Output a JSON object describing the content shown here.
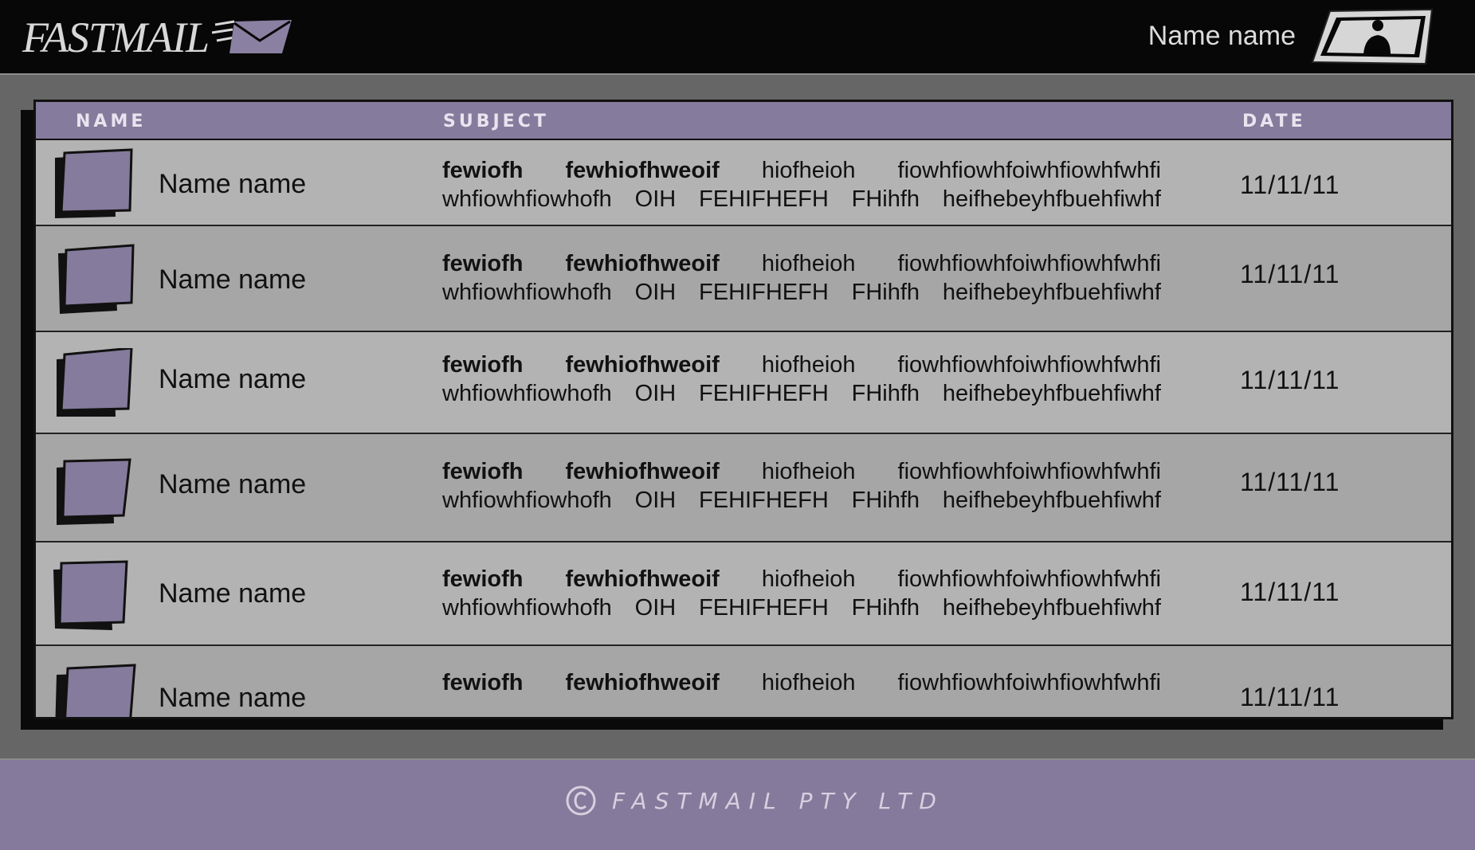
{
  "header": {
    "logo_text": "FASTMAIL",
    "user_name": "Name name"
  },
  "columns": {
    "name": "NAME",
    "subject": "SUBJECT",
    "date": "DATE"
  },
  "messages": [
    {
      "name": "Name name",
      "subject_line1": [
        "fewiofh",
        "fewhiofhweoif",
        "hiofheioh",
        "fiowhfiowhfoiwhfiowhfwhfi"
      ],
      "subject_line2": [
        "whfiowhfiowhofh",
        "OIH",
        "FEHIFHEFH",
        "FHihfh",
        "heifhebeyhfbuehfiwhf"
      ],
      "date": "11/11/11"
    },
    {
      "name": "Name name",
      "subject_line1": [
        "fewiofh",
        "fewhiofhweoif",
        "hiofheioh",
        "fiowhfiowhfoiwhfiowhfwhfi"
      ],
      "subject_line2": [
        "whfiowhfiowhofh",
        "OIH",
        "FEHIFHEFH",
        "FHihfh",
        "heifhebeyhfbuehfiwhf"
      ],
      "date": "11/11/11"
    },
    {
      "name": "Name name",
      "subject_line1": [
        "fewiofh",
        "fewhiofhweoif",
        "hiofheioh",
        "fiowhfiowhfoiwhfiowhfwhfi"
      ],
      "subject_line2": [
        "whfiowhfiowhofh",
        "OIH",
        "FEHIFHEFH",
        "FHihfh",
        "heifhebeyhfbuehfiwhf"
      ],
      "date": "11/11/11"
    },
    {
      "name": "Name name",
      "subject_line1": [
        "fewiofh",
        "fewhiofhweoif",
        "hiofheioh",
        "fiowhfiowhfoiwhfiowhfwhfi"
      ],
      "subject_line2": [
        "whfiowhfiowhofh",
        "OIH",
        "FEHIFHEFH",
        "FHihfh",
        "heifhebeyhfbuehfiwhf"
      ],
      "date": "11/11/11"
    },
    {
      "name": "Name name",
      "subject_line1": [
        "fewiofh",
        "fewhiofhweoif",
        "hiofheioh",
        "fiowhfiowhfoiwhfiowhfwhfi"
      ],
      "subject_line2": [
        "whfiowhfiowhofh",
        "OIH",
        "FEHIFHEFH",
        "FHihfh",
        "heifhebeyhfbuehfiwhf"
      ],
      "date": "11/11/11"
    },
    {
      "name": "Name name",
      "subject_line1": [
        "fewiofh",
        "fewhiofhweoif",
        "hiofheioh",
        "fiowhfiowhfoiwhfiowhfwhfi"
      ],
      "subject_line2": [],
      "date": "11/11/11"
    }
  ],
  "footer": {
    "copyright_text": "FASTMAIL PTY LTD"
  },
  "colors": {
    "accent_purple": "#857b9c",
    "header_bg": "#070707",
    "page_bg": "#666666",
    "row_light": "#b3b3b3",
    "row_dark": "#a6a6a6"
  },
  "icons": {
    "logo": "envelope-icon",
    "avatar": "user-avatar-icon",
    "thumb": "sender-avatar-icon",
    "copyright": "copyright-icon"
  }
}
